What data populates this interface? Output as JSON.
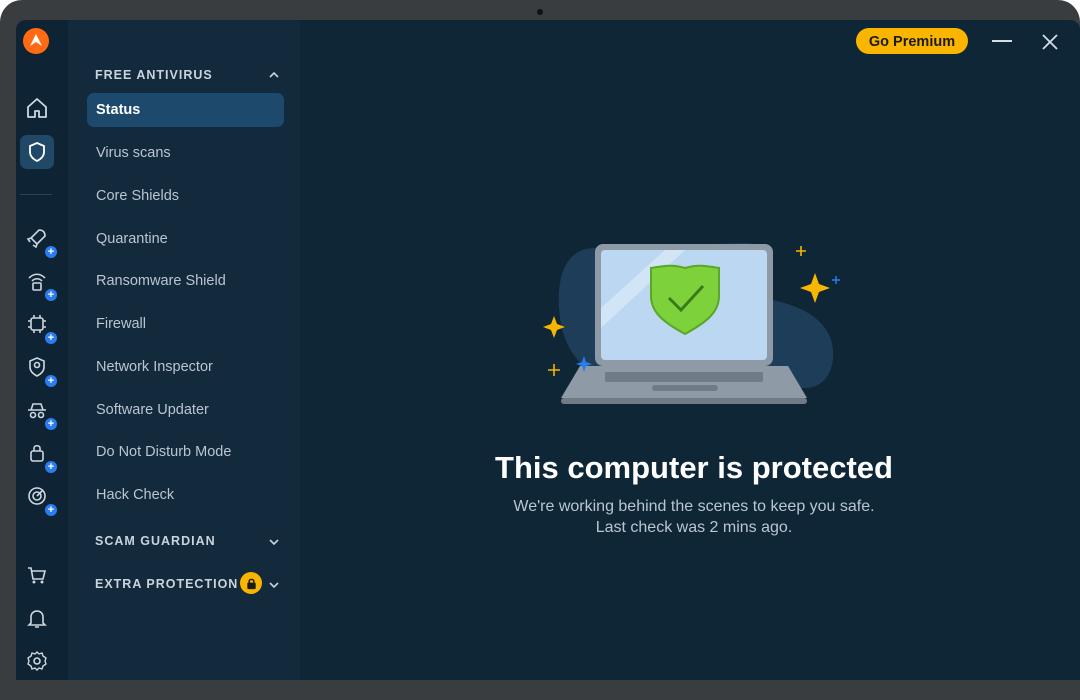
{
  "window": {
    "premium_label": "Go Premium"
  },
  "nav": {
    "sections": [
      {
        "title": "FREE ANTIVIRUS",
        "expanded": true
      },
      {
        "title": "SCAM GUARDIAN",
        "expanded": false
      },
      {
        "title": "EXTRA PROTECTION",
        "expanded": false,
        "locked": true
      }
    ],
    "items": [
      {
        "label": "Status",
        "active": true
      },
      {
        "label": "Virus scans"
      },
      {
        "label": "Core Shields"
      },
      {
        "label": "Quarantine"
      },
      {
        "label": "Ransomware Shield"
      },
      {
        "label": "Firewall"
      },
      {
        "label": "Network Inspector"
      },
      {
        "label": "Software Updater"
      },
      {
        "label": "Do Not Disturb Mode"
      },
      {
        "label": "Hack Check"
      }
    ]
  },
  "rail": {
    "icons": [
      "app-logo-icon",
      "home-icon",
      "shield-icon",
      "rocket-icon",
      "wifi-lock-icon",
      "chip-icon",
      "user-shield-icon",
      "spy-icon",
      "lock-user-icon",
      "radar-icon",
      "cart-icon",
      "bell-icon",
      "gear-icon"
    ]
  },
  "status": {
    "headline": "This computer is protected",
    "line1": "We're working behind the scenes to keep you safe.",
    "line2": "Last check was 2 mins ago."
  },
  "colors": {
    "accent": "#f9b500",
    "background": "#0f2637",
    "active_nav": "#1d4a6c",
    "shield_green": "#7dd13b"
  }
}
